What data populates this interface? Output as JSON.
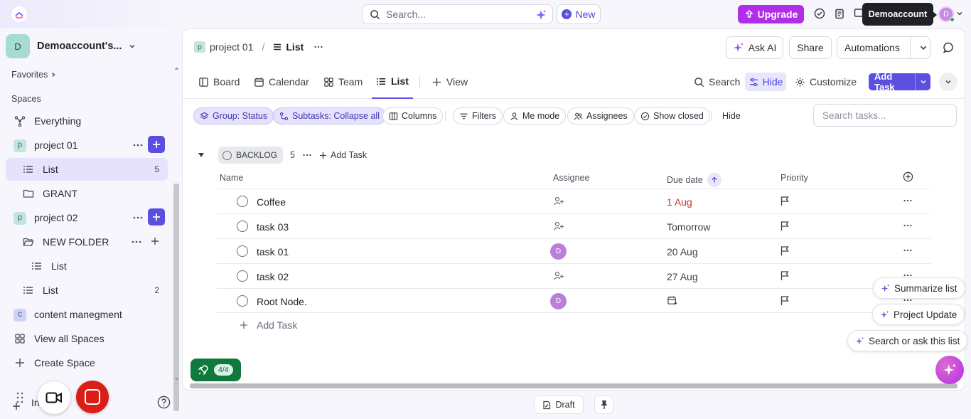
{
  "topbar": {
    "search_placeholder": "Search...",
    "new_label": "New",
    "upgrade_label": "Upgrade",
    "tooltip": "Demoaccount",
    "avatar_initial": "D"
  },
  "sidebar": {
    "workspace_initial": "D",
    "workspace_name": "Demoaccount's...",
    "favorites_label": "Favorites",
    "spaces_label": "Spaces",
    "items": [
      {
        "label": "Everything",
        "icon": "everything-icon"
      },
      {
        "label": "project 01",
        "badge": "p"
      },
      {
        "label": "List",
        "count": "5"
      },
      {
        "label": "GRANT",
        "icon": "folder-icon"
      },
      {
        "label": "project 02",
        "badge": "p"
      },
      {
        "label": "NEW FOLDER",
        "icon": "folder-open-icon"
      },
      {
        "label": "List"
      },
      {
        "label": "List",
        "count": "2"
      },
      {
        "label": "content manegment",
        "badge": "c"
      },
      {
        "label": "View all Spaces",
        "icon": "grid-icon"
      },
      {
        "label": "Create Space",
        "icon": "plus-icon"
      }
    ],
    "invite_partial": "In"
  },
  "header": {
    "crumb_badge": "p",
    "crumb_space": "project 01",
    "crumb_separator": "/",
    "crumb_list": "List",
    "ask_ai": "Ask AI",
    "share": "Share",
    "automations": "Automations"
  },
  "views": {
    "tabs": [
      "Board",
      "Calendar",
      "Team",
      "List",
      "View"
    ],
    "active": "List",
    "search": "Search",
    "hide": "Hide",
    "customize": "Customize",
    "add_task": "Add Task"
  },
  "filters": {
    "chips": [
      "Group: Status",
      "Subtasks: Collapse all",
      "Columns",
      "Filters",
      "Me mode",
      "Assignees",
      "Show closed"
    ],
    "hide": "Hide",
    "search_placeholder": "Search tasks..."
  },
  "group": {
    "status": "BACKLOG",
    "count": "5",
    "add_task": "Add Task"
  },
  "columns": {
    "name": "Name",
    "assignee": "Assignee",
    "due_date": "Due date",
    "priority": "Priority"
  },
  "tasks": [
    {
      "name": "Coffee",
      "assignee": "",
      "due": "1 Aug",
      "overdue": true
    },
    {
      "name": "task 03",
      "assignee": "",
      "due": "Tomorrow",
      "overdue": false
    },
    {
      "name": "task 01",
      "assignee": "D",
      "due": "20 Aug",
      "overdue": false
    },
    {
      "name": "task 02",
      "assignee": "",
      "due": "27 Aug",
      "overdue": false
    },
    {
      "name": "Root Node.",
      "assignee": "D",
      "due": "",
      "overdue": false
    }
  ],
  "add_task_row": "Add Task",
  "ai_suggestions": [
    "Summarize list",
    "Project Update",
    "Search or ask this list"
  ],
  "rocket_badge": "4/4",
  "bottom": {
    "draft": "Draft"
  },
  "colors": {
    "accent": "#5b4fe0",
    "upgrade": "#b02ee8",
    "overdue": "#c0392b",
    "record": "#d91e18",
    "rocket": "#0f7a3c"
  }
}
